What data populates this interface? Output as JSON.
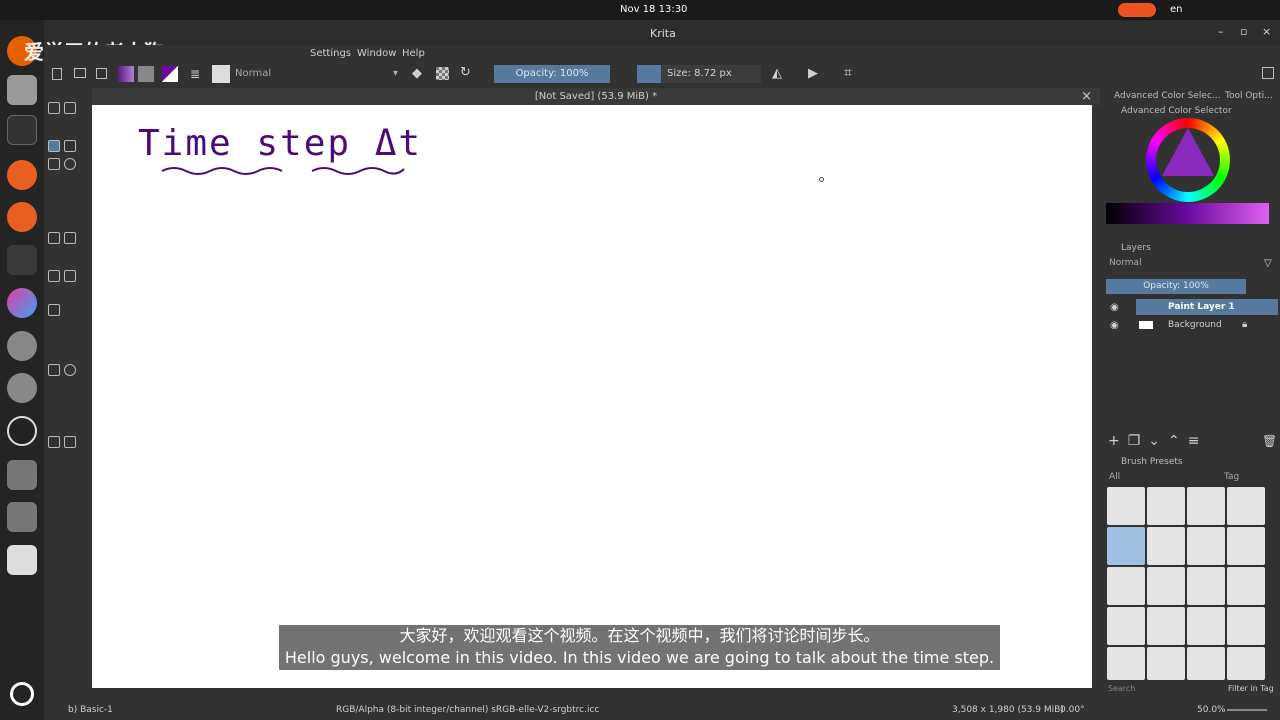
{
  "system": {
    "datetime": "Nov 18  13:30",
    "lang": "en"
  },
  "window": {
    "title": "Krita",
    "watermark": "爱学习的老土狗"
  },
  "menu": [
    "Settings",
    "Window",
    "Help"
  ],
  "toolbar": {
    "blend_mode": "Normal",
    "opacity": "Opacity: 100%",
    "size": "Size: 8.72 px"
  },
  "document": {
    "tab": "[Not Saved]  (53.9 MiB) *",
    "handwriting": "Time step Δt"
  },
  "dockers": {
    "tabs": [
      "Advanced Color Selec...",
      "Tool Opti..."
    ],
    "color_selector": "Advanced Color Selector",
    "layers": {
      "title": "Layers",
      "blend": "Normal",
      "opacity": "Opacity:  100%",
      "items": [
        {
          "name": "Paint Layer 1",
          "selected": true
        },
        {
          "name": "Background",
          "selected": false
        }
      ]
    },
    "brush_presets": {
      "title": "Brush Presets",
      "filter": "All",
      "tag": "Tag",
      "search_placeholder": "Search",
      "filter_in_tag": "Filter in Tag"
    }
  },
  "status": {
    "brush": "b) Basic-1",
    "color_space": "RGB/Alpha (8-bit integer/channel)  sRGB-elle-V2-srgbtrc.icc",
    "dimensions": "3,508 x 1,980 (53.9 MiB)",
    "rotation": "0.00°",
    "zoom": "50.0%"
  },
  "subtitles": {
    "zh": "大家好，欢迎观看这个视频。在这个视频中，我们将讨论时间步长。",
    "en": "Hello guys, welcome in this video. In this video we are going to talk about the time step."
  }
}
